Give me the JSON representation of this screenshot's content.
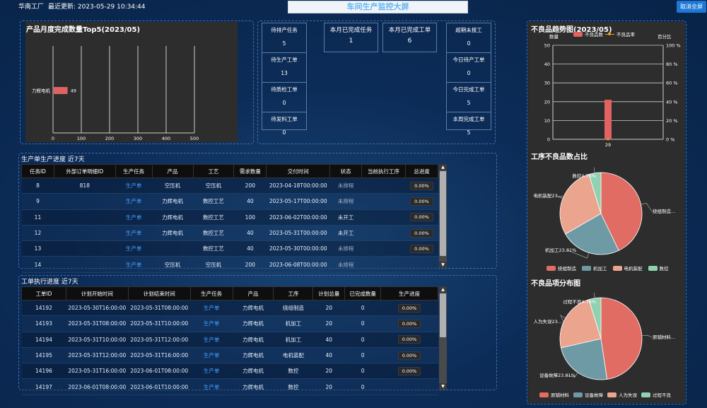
{
  "header": {
    "factory": "华南工厂",
    "last_update_label": "最近更新:",
    "last_update": "2023-05-29 10:34:44",
    "title": "车间生产监控大屏",
    "exit_fullscreen": "取消全屏"
  },
  "top5": {
    "title": "产品月度完成数量Top5(2023/05)",
    "chart_data": {
      "type": "bar",
      "orientation": "horizontal",
      "categories": [
        "力辉电机"
      ],
      "values": [
        49
      ],
      "xlim": [
        0,
        500
      ],
      "xticks": [
        "0",
        "100",
        "200",
        "300",
        "400",
        "500"
      ],
      "grid": true,
      "color": "#e06262"
    }
  },
  "stats": {
    "left": [
      {
        "label": "待排产任务",
        "value": "5"
      },
      {
        "label": "待生产工单",
        "value": "13"
      },
      {
        "label": "待质检工单",
        "value": "0"
      },
      {
        "label": "待发料工单",
        "value": "0"
      }
    ],
    "middle": [
      {
        "label": "本月已完成任务",
        "value": "1"
      },
      {
        "label": "本月已完成工单",
        "value": "6"
      }
    ],
    "right": [
      {
        "label": "超期未报工",
        "value": "0"
      },
      {
        "label": "今日待产工单",
        "value": "0"
      },
      {
        "label": "今日完成工单",
        "value": "5"
      },
      {
        "label": "本周完成工单",
        "value": "5"
      }
    ]
  },
  "production_table": {
    "title": "生产单生产进度 近7天",
    "columns": [
      "任务ID",
      "外部订单明细ID",
      "生产任务",
      "产品",
      "工艺",
      "需求数量",
      "交付时间",
      "状态",
      "当前执行工序",
      "总进度"
    ],
    "rows": [
      [
        "8",
        "818",
        "生产单",
        "空压机",
        "空压机",
        "200",
        "2023-04-18T00:00:00",
        "未排程",
        "",
        "0.00%"
      ],
      [
        "9",
        "",
        "生产单",
        "力辉电机",
        "数控工艺",
        "40",
        "2023-05-17T00:00:00",
        "未排程",
        "",
        "0.00%"
      ],
      [
        "11",
        "",
        "生产单",
        "力辉电机",
        "数控工艺",
        "100",
        "2023-06-02T00:00:00",
        "未开工",
        "",
        "0.00%"
      ],
      [
        "12",
        "",
        "生产单",
        "力辉电机",
        "数控工艺",
        "40",
        "2023-05-31T00:00:00",
        "未开工",
        "",
        "0.00%"
      ],
      [
        "13",
        "",
        "生产单",
        "",
        "数控工艺",
        "40",
        "2023-05-30T00:00:00",
        "未排程",
        "",
        "0.00%"
      ],
      [
        "14",
        "",
        "生产单",
        "空压机",
        "空压机",
        "200",
        "2023-06-08T00:00:00",
        "未排程",
        "",
        ""
      ]
    ]
  },
  "work_table": {
    "title": "工单执行进度 近7天",
    "columns": [
      "工单ID",
      "计划开始时间",
      "计划结束时间",
      "生产任务",
      "产品",
      "工序",
      "计划总量",
      "已完成数量",
      "生产进度"
    ],
    "rows": [
      [
        "14192",
        "2023-05-30T16:00:00",
        "2023-05-31T08:00:00",
        "生产单",
        "力辉电机",
        "绕组制造",
        "20",
        "0",
        "0.00%"
      ],
      [
        "14193",
        "2023-05-31T08:00:00",
        "2023-05-31T10:00:00",
        "生产单",
        "力辉电机",
        "机加工",
        "20",
        "0",
        "0.00%"
      ],
      [
        "14194",
        "2023-05-31T10:00:00",
        "2023-05-31T12:00:00",
        "生产单",
        "力辉电机",
        "机加工",
        "40",
        "0",
        "0.00%"
      ],
      [
        "14195",
        "2023-05-31T12:00:00",
        "2023-05-31T16:00:00",
        "生产单",
        "力辉电机",
        "电机装配",
        "40",
        "0",
        "0.00%"
      ],
      [
        "14196",
        "2023-05-31T16:00:00",
        "2023-06-01T08:00:00",
        "生产单",
        "力辉电机",
        "数控",
        "20",
        "0",
        "0.00%"
      ],
      [
        "14197",
        "2023-06-01T08:00:00",
        "2023-06-01T10:00:00",
        "生产单",
        "力辉电机",
        "数控",
        "20",
        "0",
        ""
      ]
    ]
  },
  "defect_trend": {
    "title": "不良品趋势图(2023/05)",
    "chart_data": {
      "type": "bar+line",
      "categories": [
        "29"
      ],
      "series": [
        {
          "name": "不良品数",
          "type": "bar",
          "values": [
            21
          ],
          "color": "#e06262"
        },
        {
          "name": "不良品率",
          "type": "line",
          "values": [
            0
          ],
          "color": "#f0a020"
        }
      ],
      "ylabel": "数量",
      "y2label": "百分比",
      "ylim": [
        0,
        50
      ],
      "yticks": [
        "0",
        "10",
        "20",
        "30",
        "40",
        "50"
      ],
      "y2ticks": [
        "0 %",
        "20 %",
        "40 %",
        "60 %",
        "80 %",
        "100 %"
      ]
    }
  },
  "process_pie": {
    "title": "工序不良品数占比",
    "chart_data": {
      "type": "pie",
      "categories": [
        "绕组制造",
        "机加工",
        "电机装配",
        "数控"
      ],
      "values": [
        42.86,
        23.81,
        28.57,
        4.76
      ],
      "colors": [
        "#e06c63",
        "#6e9aa5",
        "#eba48e",
        "#8fd2b2"
      ],
      "labels": [
        "绕组制造...",
        "机加工23.81%",
        "电机装配23...",
        "数控4.76%"
      ]
    }
  },
  "type_pie": {
    "title": "不良品项分布图",
    "chart_data": {
      "type": "pie",
      "categories": [
        "原辅材料",
        "设备故障",
        "人为失误",
        "过程不良"
      ],
      "values": [
        47.62,
        23.81,
        23.81,
        4.76
      ],
      "colors": [
        "#e06c63",
        "#6e9aa5",
        "#eba48e",
        "#8fd2b2"
      ],
      "labels": [
        "原辅材料...",
        "设备故障23.81%",
        "人为失误23...",
        "过程不良4.76%"
      ]
    }
  }
}
